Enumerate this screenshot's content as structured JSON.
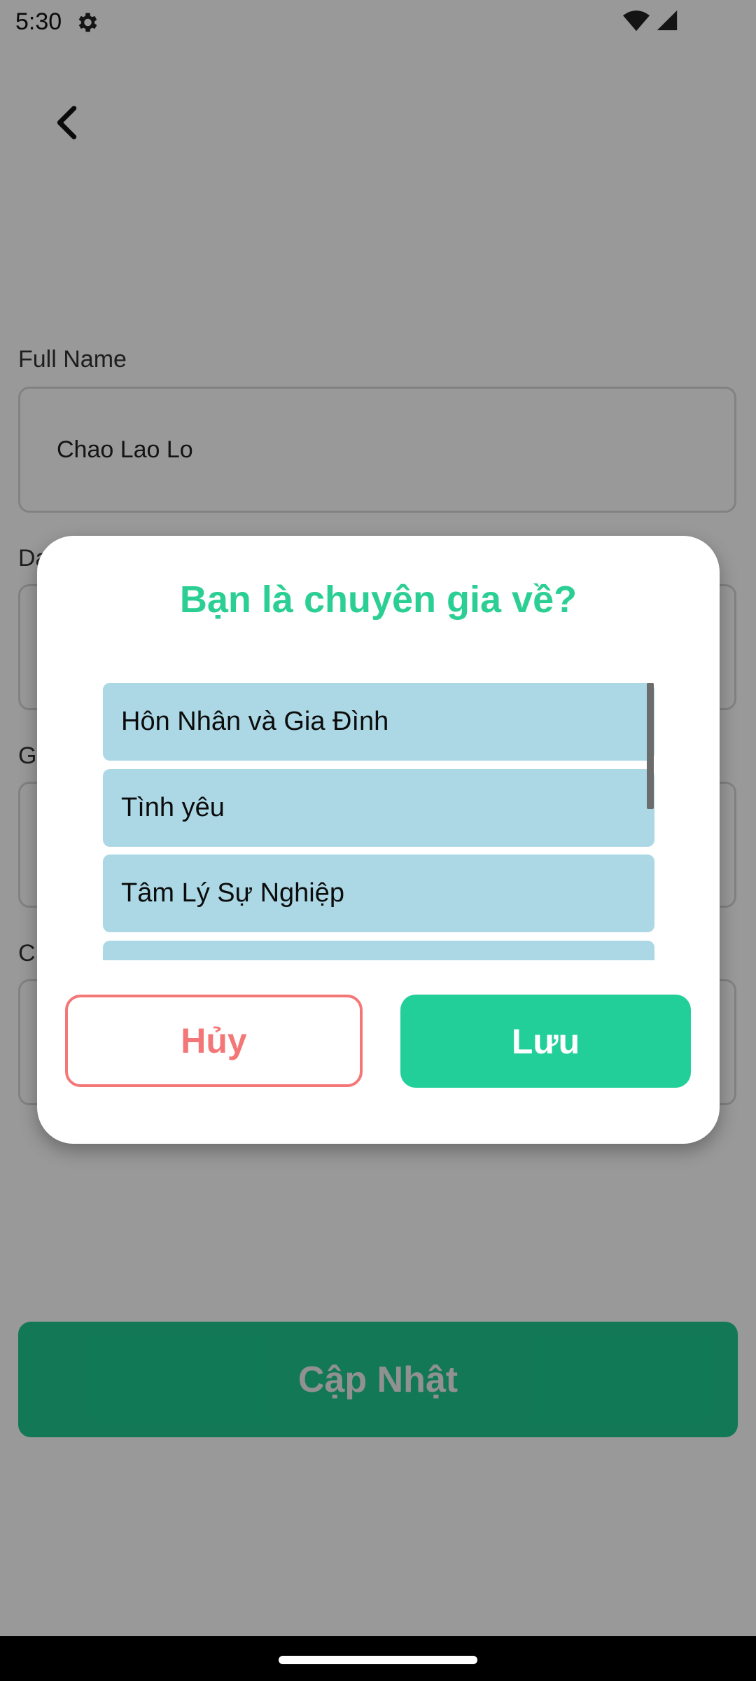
{
  "status_bar": {
    "time": "5:30",
    "icons": [
      "gear-icon",
      "wifi-icon",
      "signal-icon"
    ]
  },
  "form": {
    "full_name": {
      "label": "Full Name",
      "value": "Chao Lao Lo"
    },
    "partial_labels": [
      "Da",
      "G",
      "C"
    ],
    "submit_label": "Cập Nhật"
  },
  "dialog": {
    "title": "Bạn là chuyên gia về?",
    "options": [
      "Hôn Nhân và Gia Đình",
      "Tình yêu",
      "Tâm Lý Sự Nghiệp",
      ""
    ],
    "cancel_label": "Hủy",
    "save_label": "Lưu"
  },
  "colors": {
    "accent": "#23cf99",
    "title": "#2bcf93",
    "danger": "#f47778",
    "option_bg": "#acd8e6"
  }
}
